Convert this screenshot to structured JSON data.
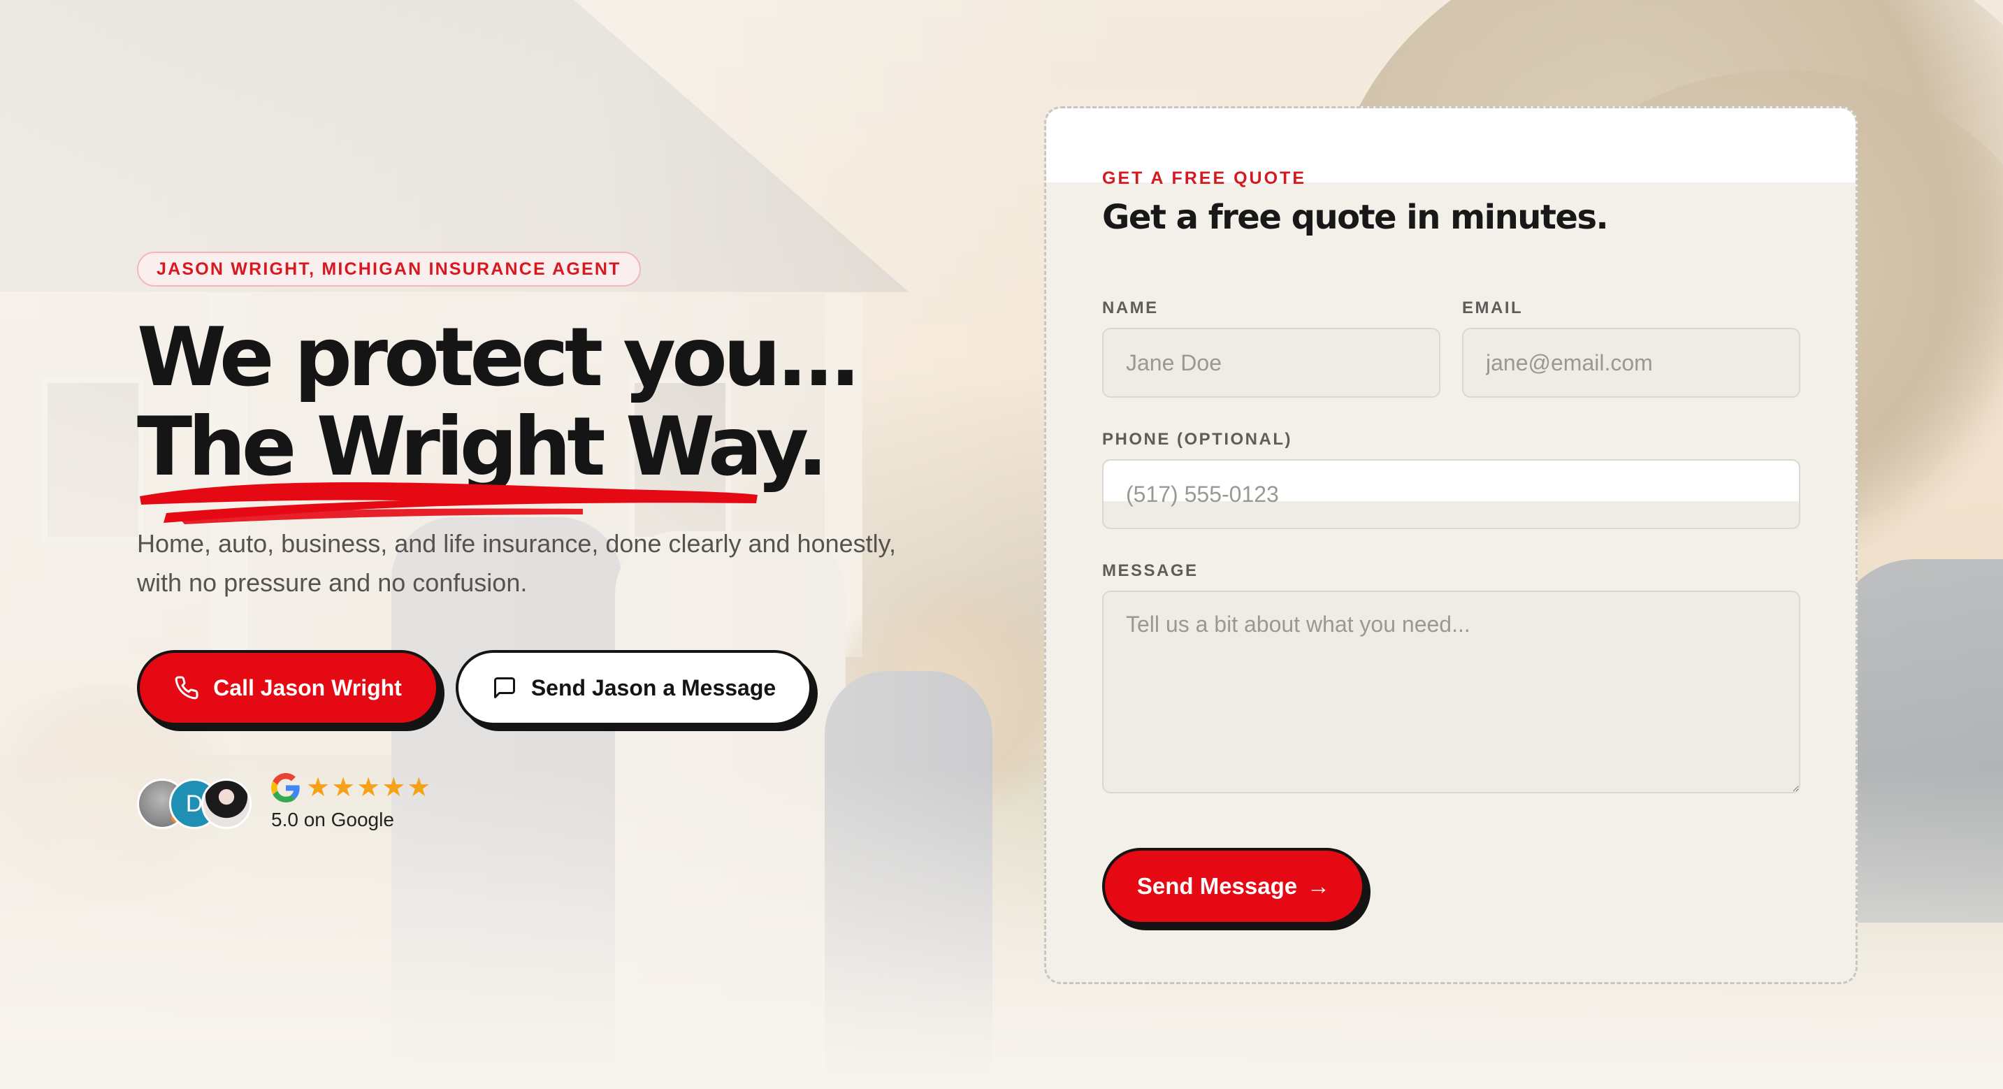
{
  "hero": {
    "badge": "JASON WRIGHT, MICHIGAN INSURANCE AGENT",
    "headline_line1": "We protect you...",
    "headline_line2": "The Wright Way.",
    "subcopy_line1": "Home, auto, business, and life insurance, done clearly and honestly,",
    "subcopy_line2": "with no pressure and no confusion.",
    "call_button": "Call Jason Wright",
    "message_button": "Send Jason a Message",
    "avatar_initial": "D",
    "stars": "★★★★★",
    "rating_text": "5.0 on Google"
  },
  "form": {
    "eyebrow": "GET A FREE QUOTE",
    "title": "Get a free quote in minutes.",
    "name_label": "NAME",
    "name_placeholder": "Jane Doe",
    "email_label": "EMAIL",
    "email_placeholder": "jane@email.com",
    "phone_label": "PHONE (OPTIONAL)",
    "phone_placeholder": "(517) 555-0123",
    "message_label": "MESSAGE",
    "message_placeholder": "Tell us a bit about what you need...",
    "send_button": "Send Message",
    "send_arrow": "→"
  },
  "colors": {
    "accent": "#e50914",
    "ink": "#141414",
    "card_bg": "#f3f0e9"
  },
  "icons": [
    "phone-icon",
    "chat-bubble-icon",
    "google-g-icon",
    "arrow-right-icon"
  ]
}
